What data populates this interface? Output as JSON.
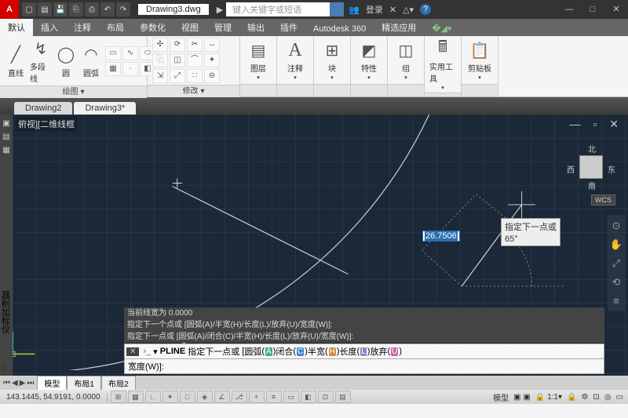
{
  "title": {
    "filename": "Drawing3.dwg",
    "search_placeholder": "键入关键字或短语",
    "login": "登录"
  },
  "menu": {
    "tabs": [
      "默认",
      "插入",
      "注释",
      "布局",
      "参数化",
      "视图",
      "管理",
      "输出",
      "插件",
      "Autodesk 360",
      "精选应用"
    ],
    "active": 0
  },
  "ribbon": {
    "draw": {
      "title": "绘图",
      "line": "直线",
      "polyline": "多段线",
      "circle": "圆",
      "arc": "圆弧"
    },
    "modify": {
      "title": "修改"
    },
    "layer": "图层",
    "annotate": "注释",
    "block": "块",
    "properties": "特性",
    "group": "组",
    "utilities": "实用工具",
    "clipboard": "剪贴板"
  },
  "doctabs": {
    "tabs": [
      "Drawing2",
      "Drawing3*"
    ],
    "active": 1
  },
  "viewport": {
    "label": "俯视][二维线框",
    "cube": {
      "n": "北",
      "s": "南",
      "e": "东",
      "w": "西"
    },
    "wcs": "WCS",
    "dynamic_input": "26.7506",
    "tooltip": "指定下一点或",
    "angle": "65°"
  },
  "sidebar_text": "器削加标仪",
  "command": {
    "hist1": "当前线宽为  0.0000",
    "hist2": "指定下一个点或 [圆弧(A)/半宽(H)/长度(L)/放弃(U)/宽度(W)]:",
    "hist3": "指定下一点或 [圆弧(A)/闭合(C)/半宽(H)/长度(L)/放弃(U)/宽度(W)]:",
    "name": "PLINE",
    "prompt": "指定下一点或",
    "opts": {
      "a": "圆弧",
      "c": "闭合",
      "h": "半宽",
      "l": "长度",
      "u": "放弃",
      "w": "宽度"
    },
    "line2": "宽度(W)]:"
  },
  "layout": {
    "tabs": [
      "模型",
      "布局1",
      "布局2"
    ],
    "active": 0
  },
  "status": {
    "coords": "143.1445, 54.9191, 0.0000",
    "model": "模型",
    "scale": "1:1"
  }
}
